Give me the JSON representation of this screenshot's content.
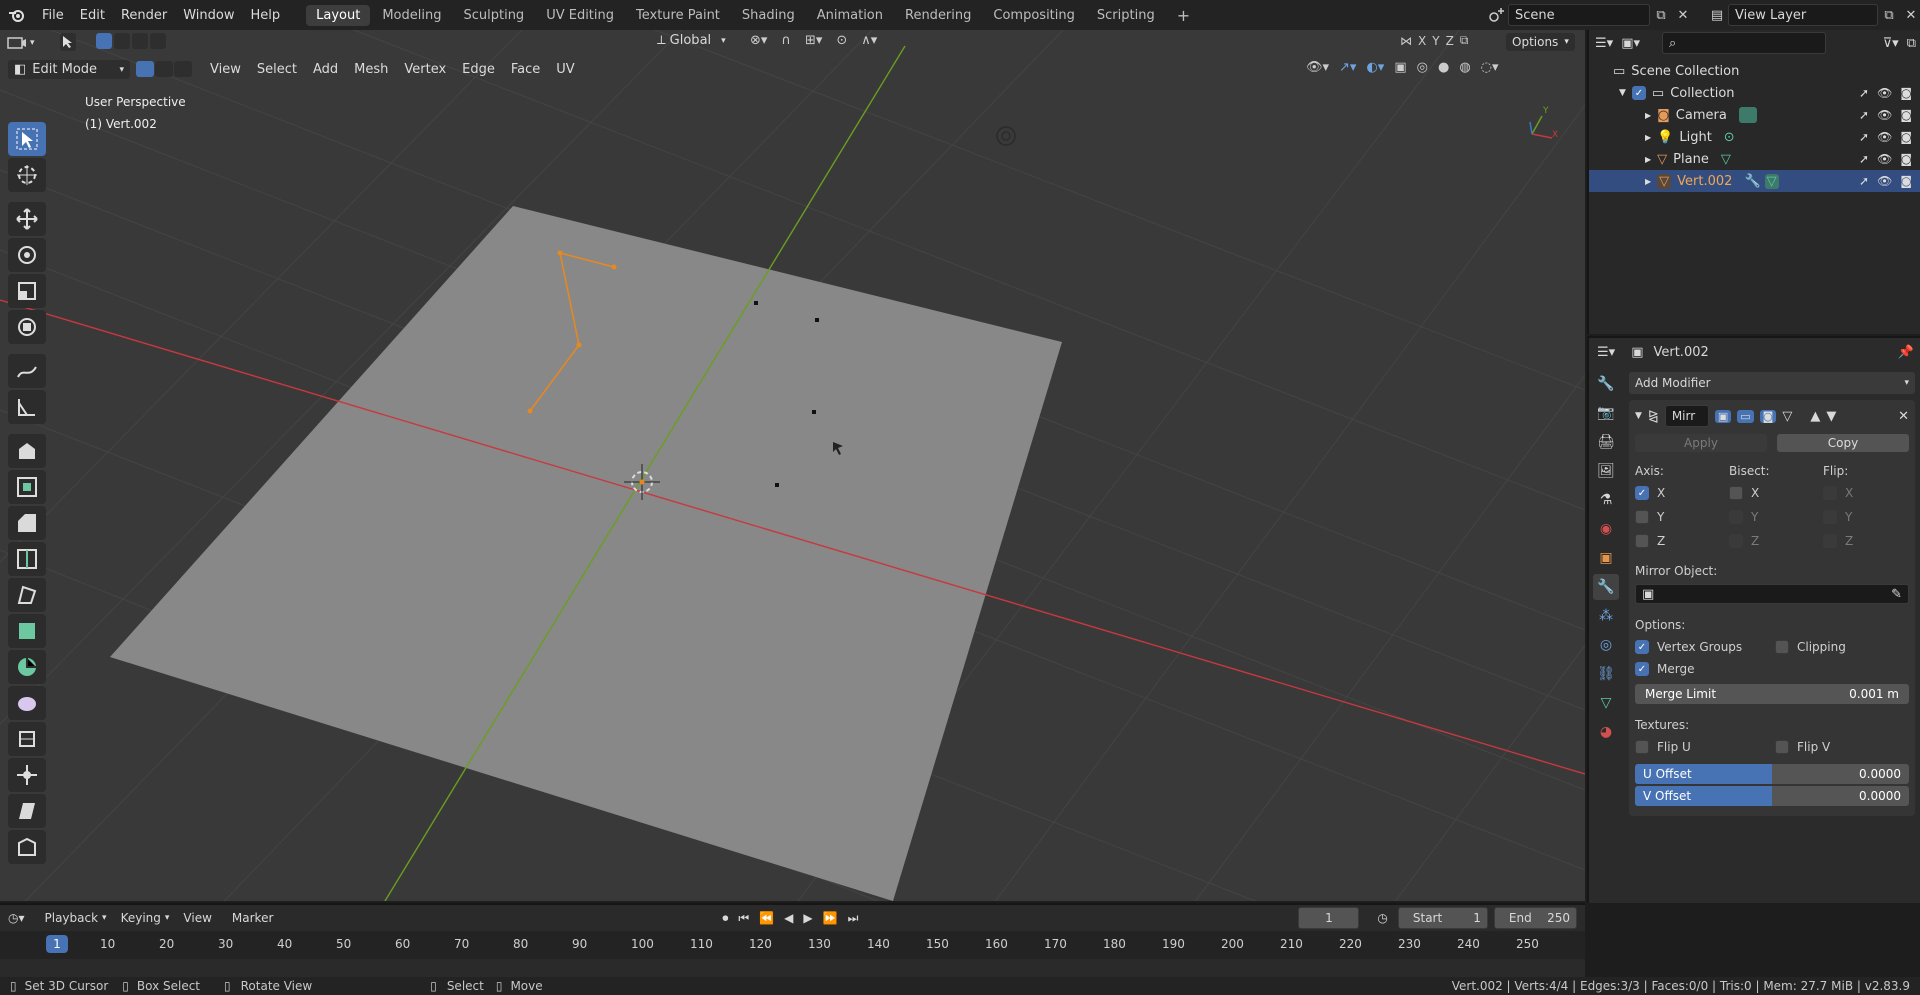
{
  "topbar": {
    "menus": [
      "File",
      "Edit",
      "Render",
      "Window",
      "Help"
    ],
    "workspaces": [
      "Layout",
      "Modeling",
      "Sculpting",
      "UV Editing",
      "Texture Paint",
      "Shading",
      "Animation",
      "Rendering",
      "Compositing",
      "Scripting"
    ],
    "active_workspace": "Layout",
    "add_tab": "+",
    "scene_name": "Scene",
    "view_layer_name": "View Layer"
  },
  "viewport_header": {
    "mode": "Edit Mode",
    "menus": [
      "View",
      "Select",
      "Add",
      "Mesh",
      "Vertex",
      "Edge",
      "Face",
      "UV"
    ],
    "transform_orientation": "Global",
    "axis_x": "X",
    "axis_y": "Y",
    "axis_z": "Z",
    "options_label": "Options"
  },
  "viewport": {
    "perspective_label": "User Perspective",
    "object_label": "(1) Vert.002",
    "gizmo_x": "X",
    "gizmo_y": "Y"
  },
  "outliner": {
    "search_placeholder": "",
    "scene_collection": "Scene Collection",
    "collection": "Collection",
    "objects": [
      {
        "name": "Camera",
        "type": "camera",
        "selected": false
      },
      {
        "name": "Light",
        "type": "light",
        "selected": false
      },
      {
        "name": "Plane",
        "type": "mesh",
        "selected": false
      },
      {
        "name": "Vert.002",
        "type": "mesh",
        "selected": true
      }
    ]
  },
  "properties": {
    "object_name": "Vert.002",
    "add_modifier": "Add Modifier",
    "modifier_name": "Mirr",
    "apply_label": "Apply",
    "copy_label": "Copy",
    "axis_label": "Axis:",
    "bisect_label": "Bisect:",
    "flip_label": "Flip:",
    "axis": [
      {
        "label": "X",
        "checked": true
      },
      {
        "label": "Y",
        "checked": false
      },
      {
        "label": "Z",
        "checked": false
      }
    ],
    "bisect": [
      {
        "label": "X",
        "checked": false
      },
      {
        "label": "Y",
        "checked": false
      },
      {
        "label": "Z",
        "checked": false
      }
    ],
    "flip": [
      {
        "label": "X",
        "checked": false
      },
      {
        "label": "Y",
        "checked": false
      },
      {
        "label": "Z",
        "checked": false
      }
    ],
    "mirror_object_label": "Mirror Object:",
    "options_label": "Options:",
    "vertex_groups_label": "Vertex Groups",
    "vertex_groups_checked": true,
    "clipping_label": "Clipping",
    "clipping_checked": false,
    "merge_label": "Merge",
    "merge_checked": true,
    "merge_limit_label": "Merge Limit",
    "merge_limit_value": "0.001 m",
    "textures_label": "Textures:",
    "flip_u_label": "Flip U",
    "flip_v_label": "Flip V",
    "u_offset_label": "U Offset",
    "u_offset_value": "0.0000",
    "v_offset_label": "V Offset",
    "v_offset_value": "0.0000"
  },
  "timeline": {
    "menus": [
      "Playback",
      "Keying",
      "View",
      "Marker"
    ],
    "current_frame": "1",
    "start_label": "Start",
    "start_value": "1",
    "end_label": "End",
    "end_value": "250",
    "ruler": [
      "10",
      "20",
      "30",
      "40",
      "50",
      "60",
      "70",
      "80",
      "90",
      "100",
      "110",
      "120",
      "130",
      "140",
      "150",
      "160",
      "170",
      "180",
      "190",
      "200",
      "210",
      "220",
      "230",
      "240",
      "250"
    ],
    "ruler_current": "1"
  },
  "statusbar": {
    "hint1": "Set 3D Cursor",
    "hint2": "Box Select",
    "hint3": "Rotate View",
    "hint4": "Select",
    "hint5": "Move",
    "stats": "Vert.002 | Verts:4/4 | Edges:3/3 | Faces:0/0 | Tris:0 | Mem: 27.7 MiB | v2.83.9"
  },
  "colors": {
    "accent": "#4772b3",
    "selection": "#334d80",
    "x_axis": "#c8383f",
    "y_axis": "#6a9e1f",
    "edit_orange": "#e8891e"
  }
}
